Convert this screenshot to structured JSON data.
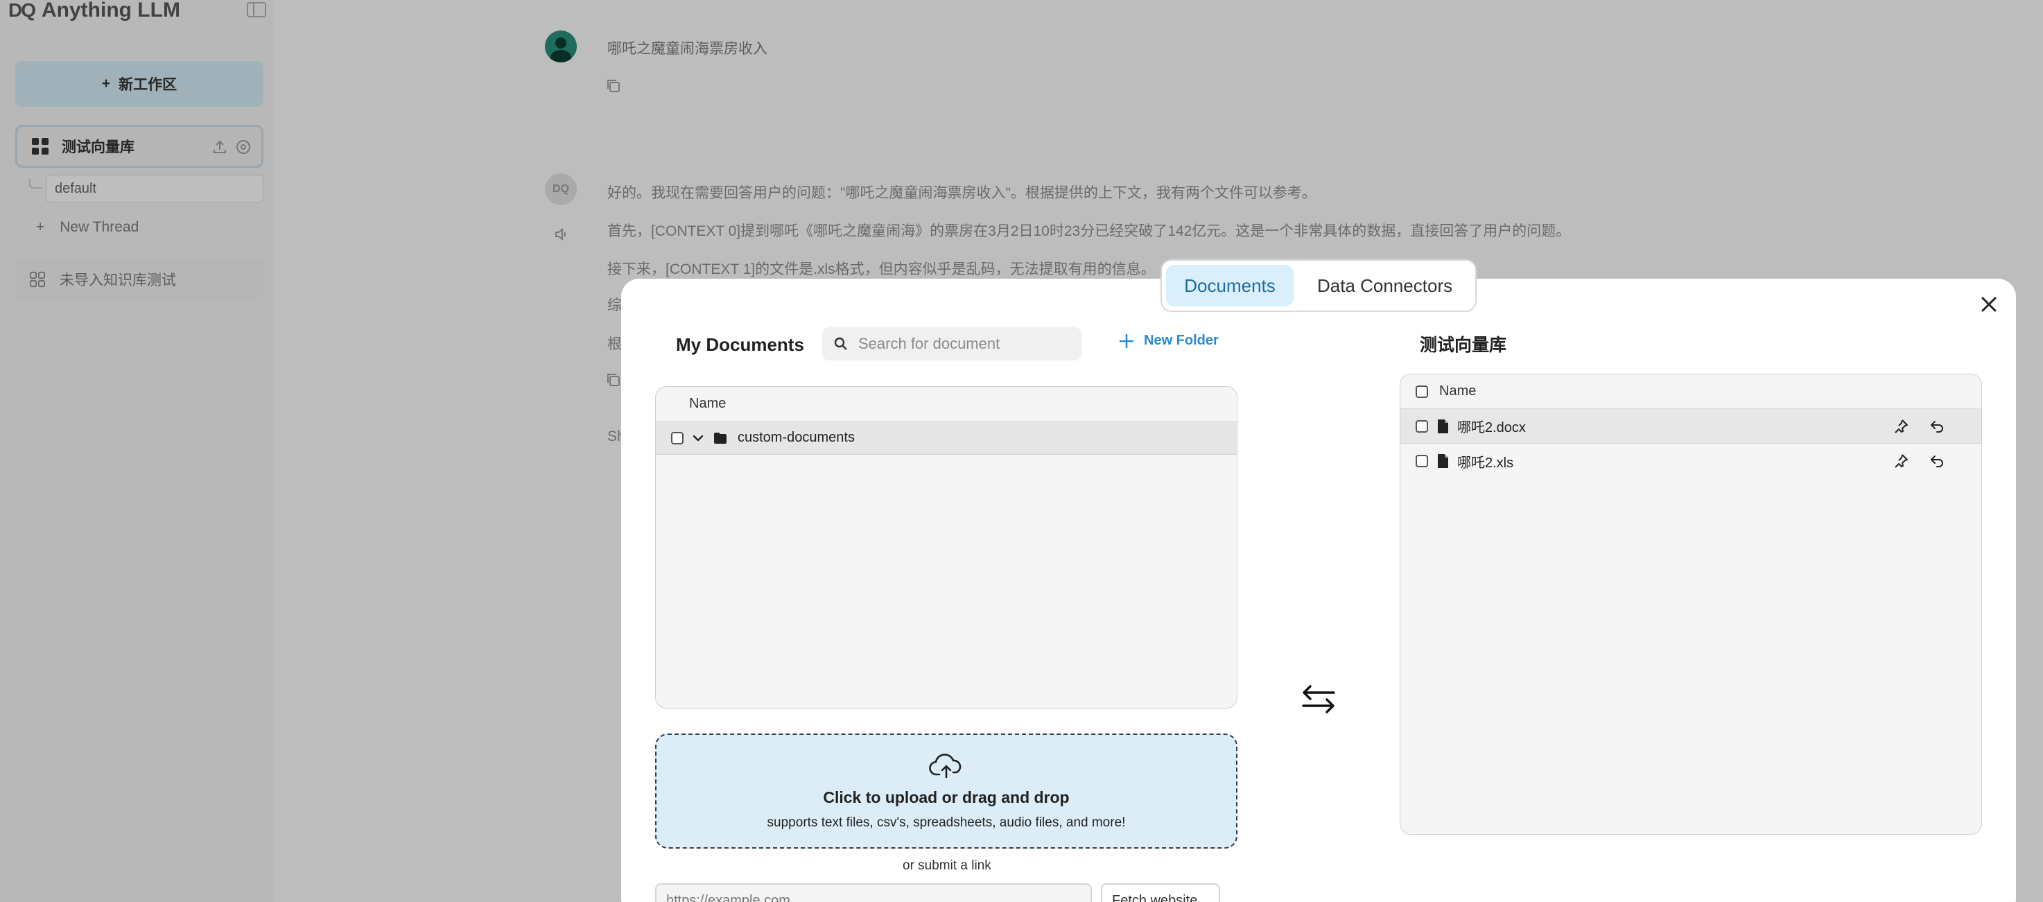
{
  "app": {
    "brand": "Anything LLM",
    "brand_mark": "DQ"
  },
  "sidebar": {
    "new_workspace_label": "新工作区",
    "workspaces": [
      {
        "label": "测试向量库",
        "active": true
      },
      {
        "label": "未导入知识库测试",
        "active": false
      }
    ],
    "threads": [
      {
        "label": "default"
      }
    ],
    "new_thread_label": "New Thread"
  },
  "chat": {
    "user_message": "哪吒之魔童闹海票房收入",
    "bot_avatar_text": "DQ",
    "reply_lines": [
      "好的。我现在需要回答用户的问题：\"哪吒之魔童闹海票房收入\"。根据提供的上下文，我有两个文件可以参考。",
      "首先，[CONTEXT 0]提到哪吒《哪吒之魔童闹海》的票房在3月2日10时23分已经突破了142亿元。这是一个非常具体的数据，直接回答了用户的问题。",
      "接下来，[CONTEXT 1]的文件是.xls格式，但内容似乎是乱码，无法提取有用的信息。",
      "综",
      "根",
      "Sh"
    ]
  },
  "modal": {
    "tabs": [
      {
        "label": "Documents",
        "active": true
      },
      {
        "label": "Data Connectors",
        "active": false
      }
    ],
    "left": {
      "title": "My Documents",
      "search_placeholder": "Search for document",
      "new_folder_label": "New Folder",
      "column_name": "Name",
      "folders": [
        {
          "name": "custom-documents",
          "expanded": true
        }
      ],
      "upload_title": "Click to upload or drag and drop",
      "upload_subtitle": "supports text files, csv's, spreadsheets, audio files, and more!",
      "submit_link_label": "or submit a link",
      "link_placeholder": "https://example.com",
      "fetch_button": "Fetch website"
    },
    "right": {
      "title": "测试向量库",
      "column_name": "Name",
      "files": [
        {
          "name": "哪吒2.docx"
        },
        {
          "name": "哪吒2.xls"
        }
      ]
    }
  },
  "colors": {
    "accent": "#2a8bd0",
    "tab_active_bg": "#dbeefb",
    "upload_bg": "#dcedf8"
  }
}
